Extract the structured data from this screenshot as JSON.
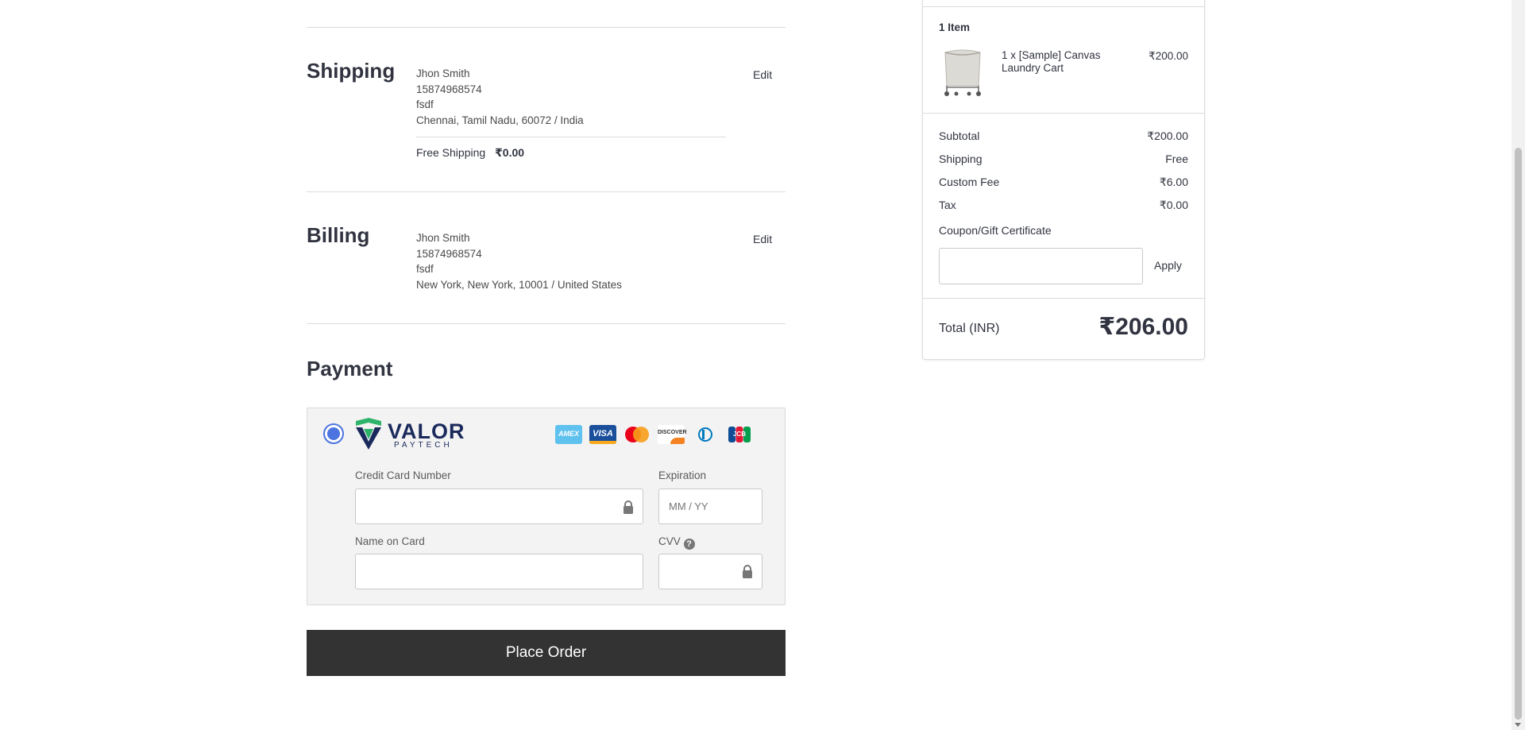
{
  "shipping": {
    "title": "Shipping",
    "name": "Jhon Smith",
    "phone": "15874968574",
    "company": "fsdf",
    "address": "Chennai, Tamil Nadu, 60072 / India",
    "method": "Free Shipping",
    "price": "₹0.00",
    "edit": "Edit"
  },
  "billing": {
    "title": "Billing",
    "name": "Jhon Smith",
    "phone": "15874968574",
    "company": "fsdf",
    "address": "New York, New York, 10001 / United States",
    "edit": "Edit"
  },
  "payment": {
    "title": "Payment",
    "provider_name": "VALOR",
    "provider_sub": "PAYTECH",
    "cards": [
      "amex",
      "visa",
      "mastercard",
      "discover",
      "diners",
      "jcb"
    ],
    "card_texts": {
      "amex": "AMEX",
      "visa": "VISA",
      "discover": "DISCOVER",
      "jcb": "JCB"
    },
    "cc_number_label": "Credit Card Number",
    "expiration_label": "Expiration",
    "expiration_placeholder": "MM / YY",
    "name_label": "Name on Card",
    "cvv_label": "CVV",
    "cvv_help": "?"
  },
  "place_order": "Place Order",
  "summary": {
    "items_count": "1 Item",
    "item_name": "1 x [Sample] Canvas Laundry Cart",
    "item_price": "₹200.00",
    "subtotal_label": "Subtotal",
    "subtotal": "₹200.00",
    "shipping_label": "Shipping",
    "shipping": "Free",
    "fee_label": "Custom Fee",
    "fee": "₹6.00",
    "tax_label": "Tax",
    "tax": "₹0.00",
    "coupon_label": "Coupon/Gift Certificate",
    "apply": "Apply",
    "total_label": "Total (INR)",
    "total": "₹206.00"
  },
  "colors": {
    "accent": "#4b74e0",
    "valor_green": "#2db36a",
    "valor_navy": "#1b2a5c",
    "button_bg": "#333333"
  }
}
